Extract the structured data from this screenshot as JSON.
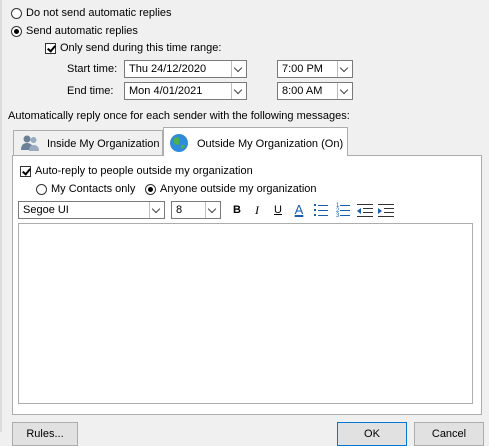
{
  "replies": {
    "no_auto_label": "Do not send automatic replies",
    "send_auto_label": "Send automatic replies",
    "time_range_label": "Only send during this time range:"
  },
  "times": {
    "start_label": "Start time:",
    "start_date": "Thu 24/12/2020",
    "start_time": "7:00 PM",
    "end_label": "End time:",
    "end_date": "Mon 4/01/2021",
    "end_time": "8:00 AM"
  },
  "reply_once_text": "Automatically reply once for each sender with the following messages:",
  "tabs": {
    "inside_label": "Inside My Organization",
    "outside_label": "Outside My Organization (On)"
  },
  "outside": {
    "autoreply_label": "Auto-reply to people outside my organization",
    "contacts_label": "My Contacts only",
    "anyone_label": "Anyone outside my organization"
  },
  "formatting": {
    "font_name": "Segoe UI",
    "font_size": "8",
    "bold": "B",
    "italic": "I",
    "underline": "U",
    "font_color": "A",
    "font_color_value": "#1a5ea8"
  },
  "buttons": {
    "rules_label": "Rules...",
    "ok_label": "OK",
    "cancel_label": "Cancel"
  },
  "icons": {
    "inside_tab_icon": "people-icon",
    "outside_tab_icon": "globe-icon"
  }
}
